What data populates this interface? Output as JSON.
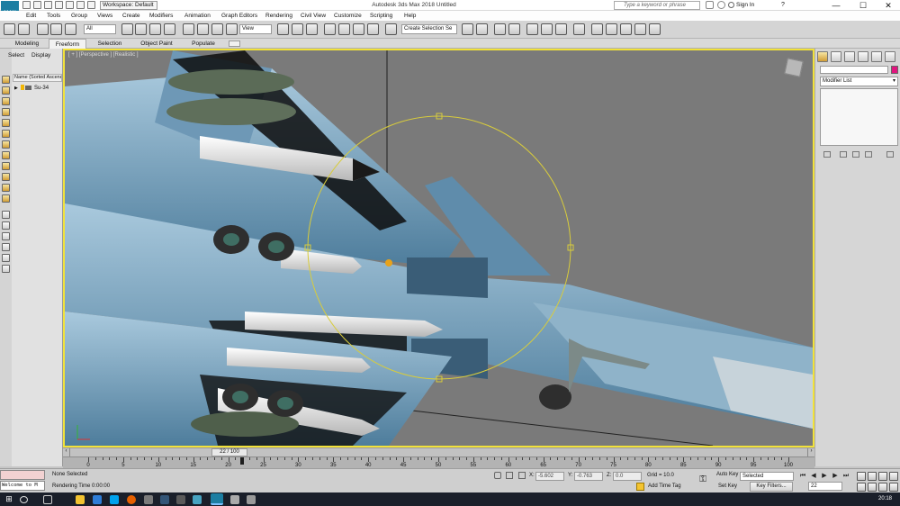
{
  "titlebar": {
    "app_logo": "MAX",
    "workspace": "Workspace: Default",
    "title": "Autodesk 3ds Max 2018     Untitled",
    "search_placeholder": "Type a keyword or phrase",
    "sign_in": "Sign In",
    "help": "?",
    "minimize": "—",
    "maximize": "☐",
    "close": "✕"
  },
  "menu": [
    "Edit",
    "Tools",
    "Group",
    "Views",
    "Create",
    "Modifiers",
    "Animation",
    "Graph Editors",
    "Rendering",
    "Civil View",
    "Customize",
    "Scripting",
    "Help"
  ],
  "toolbar": {
    "filter": "All",
    "view": "View",
    "selection_set": "Create Selection Se"
  },
  "ribbon": {
    "tabs": [
      "Modeling",
      "Freeform",
      "Selection",
      "Object Paint",
      "Populate"
    ],
    "active": "Freeform"
  },
  "scene_explorer": {
    "tabs": [
      "Select",
      "Display"
    ],
    "header": "Name (Sorted Ascend",
    "items": [
      "Su-34"
    ]
  },
  "viewport": {
    "label": "[ + ] [Perspective ] [Realistic ]"
  },
  "command_panel": {
    "modifier_list": "Modifier List",
    "color": "#e0157f"
  },
  "timeline": {
    "frame_display": "22 / 100",
    "ticks": [
      0,
      5,
      10,
      15,
      20,
      25,
      30,
      35,
      40,
      45,
      50,
      55,
      60,
      65,
      70,
      75,
      80,
      85,
      90,
      95,
      100
    ],
    "current_frame": 22,
    "total_frames": 100
  },
  "status": {
    "selection": "None Selected",
    "rendering": "Rendering Time  0:00:00",
    "script_welcome": "Welcome to M",
    "x_label": "X:",
    "x": "-5.602",
    "y_label": "Y:",
    "y": "-0.763",
    "z_label": "Z:",
    "z": "0.0",
    "grid": "Grid = 10.0",
    "add_time_tag": "Add Time Tag",
    "auto_key": "Auto Key",
    "set_key": "Set Key",
    "selected_dropdown": "Selected",
    "key_filters": "Key Filters...",
    "frame_field": "22"
  },
  "taskbar": {
    "clock": "20:18"
  },
  "colors": {
    "viewport_border": "#f2e23a",
    "gizmo": "#d8cc3c"
  }
}
